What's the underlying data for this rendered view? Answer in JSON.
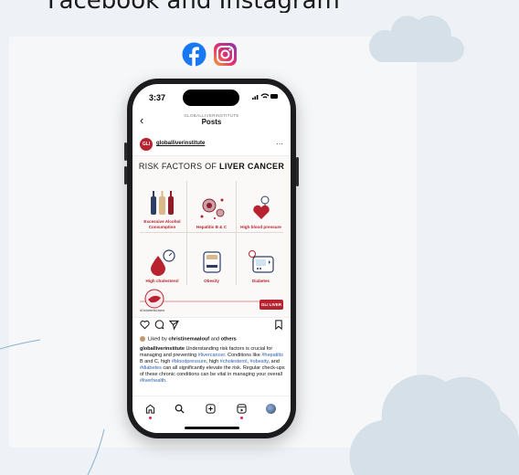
{
  "page": {
    "caption": "Facebook and Instagram"
  },
  "social_icons": [
    "facebook-icon",
    "instagram-icon"
  ],
  "colors": {
    "brand": "#b8222e",
    "background": "#eef2f6",
    "cloud": "#d6e0e8",
    "link": "#2a5db0"
  },
  "phone": {
    "status_time": "3:37",
    "header_account": "GLOBALLIVERINSTITUTE",
    "header_title": "Posts",
    "post": {
      "username": "globalliverinstitute",
      "avatar_text": "GLI",
      "title_light": "RISK FACTORS OF",
      "title_bold": "LIVER CANCER",
      "factors": [
        {
          "label": "Excessive Alcohol Consumption",
          "icon": "alcohol-bottles-icon"
        },
        {
          "label": "Hepatitis B & C",
          "icon": "virus-icon"
        },
        {
          "label": "High blood pressure",
          "icon": "heart-pressure-icon"
        },
        {
          "label": "High cholesterol",
          "icon": "blood-drop-gauge-icon"
        },
        {
          "label": "Obesity",
          "icon": "scale-icon"
        },
        {
          "label": "Diabetes",
          "icon": "glucose-meter-icon"
        }
      ],
      "hashtag_label": "#OctoberIsLivers",
      "brand_mark": "GLI LIVER",
      "likes_prefix": "Liked by",
      "likes_user": "christinemaalouf",
      "likes_join": "and",
      "likes_others": "others",
      "caption_user": "globalliverinstitute",
      "caption_part1": "Understanding risk factors is crucial for managing and preventing",
      "tag_livercancer": "#livercancer",
      "caption_part2": ". Conditions like",
      "tag_hepatitis": "#hepatitis",
      "caption_part3": "B and C, high",
      "tag_bloodpressure": "#bloodpressure",
      "caption_part4": ", high",
      "tag_cholesterol": "#cholesterol",
      "caption_part5": ",",
      "tag_obesity": "#obesity",
      "caption_part6": ", and",
      "tag_diabetes": "#diabetes",
      "caption_part7": "can all significantly elevate the risk. Regular check-ups of these chronic conditions can be vital in managing your overall",
      "tag_liverhealth": "#liverhealth",
      "caption_part8": "."
    },
    "tabs": [
      "home-icon",
      "search-icon",
      "create-icon",
      "reels-icon",
      "profile-icon"
    ]
  }
}
